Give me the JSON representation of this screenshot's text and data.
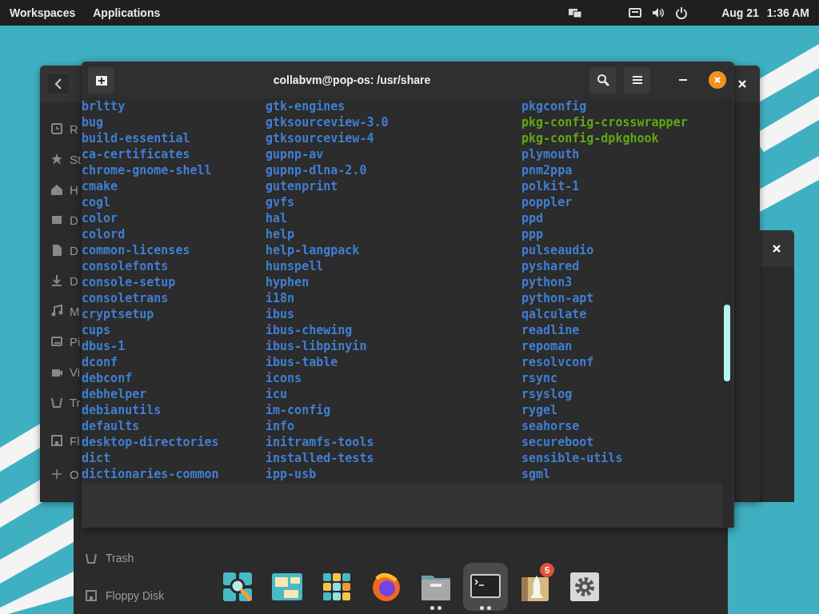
{
  "top_bar": {
    "menus": [
      "Workspaces",
      "Applications"
    ],
    "date": "Aug 21",
    "time": "1:36 AM"
  },
  "back_window": {
    "sidebar": [
      "R",
      "St",
      "H",
      "D",
      "D",
      "D",
      "M",
      "Pi",
      "Vi",
      "Tr",
      "Fl",
      "O"
    ]
  },
  "lower_window": {
    "sidebar": [
      "Trash",
      "Floppy Disk"
    ]
  },
  "terminal": {
    "title": "collabvm@pop-os: /usr/share",
    "columns": [
      [
        {
          "name": "brltty",
          "kind": "dir"
        },
        {
          "name": "bug",
          "kind": "dir"
        },
        {
          "name": "build-essential",
          "kind": "dir"
        },
        {
          "name": "ca-certificates",
          "kind": "dir"
        },
        {
          "name": "chrome-gnome-shell",
          "kind": "dir"
        },
        {
          "name": "cmake",
          "kind": "dir"
        },
        {
          "name": "cogl",
          "kind": "dir"
        },
        {
          "name": "color",
          "kind": "dir"
        },
        {
          "name": "colord",
          "kind": "dir"
        },
        {
          "name": "common-licenses",
          "kind": "dir"
        },
        {
          "name": "consolefonts",
          "kind": "dir"
        },
        {
          "name": "console-setup",
          "kind": "dir"
        },
        {
          "name": "consoletrans",
          "kind": "dir"
        },
        {
          "name": "cryptsetup",
          "kind": "dir"
        },
        {
          "name": "cups",
          "kind": "dir"
        },
        {
          "name": "dbus-1",
          "kind": "dir"
        },
        {
          "name": "dconf",
          "kind": "dir"
        },
        {
          "name": "debconf",
          "kind": "dir"
        },
        {
          "name": "debhelper",
          "kind": "dir"
        },
        {
          "name": "debianutils",
          "kind": "dir"
        },
        {
          "name": "defaults",
          "kind": "dir"
        },
        {
          "name": "desktop-directories",
          "kind": "dir"
        },
        {
          "name": "dict",
          "kind": "dir"
        },
        {
          "name": "dictionaries-common",
          "kind": "dir"
        }
      ],
      [
        {
          "name": "gtk-engines",
          "kind": "dir"
        },
        {
          "name": "gtksourceview-3.0",
          "kind": "dir"
        },
        {
          "name": "gtksourceview-4",
          "kind": "dir"
        },
        {
          "name": "gupnp-av",
          "kind": "dir"
        },
        {
          "name": "gupnp-dlna-2.0",
          "kind": "dir"
        },
        {
          "name": "gutenprint",
          "kind": "dir"
        },
        {
          "name": "gvfs",
          "kind": "dir"
        },
        {
          "name": "hal",
          "kind": "dir"
        },
        {
          "name": "help",
          "kind": "dir"
        },
        {
          "name": "help-langpack",
          "kind": "dir"
        },
        {
          "name": "hunspell",
          "kind": "dir"
        },
        {
          "name": "hyphen",
          "kind": "dir"
        },
        {
          "name": "i18n",
          "kind": "dir"
        },
        {
          "name": "ibus",
          "kind": "dir"
        },
        {
          "name": "ibus-chewing",
          "kind": "dir"
        },
        {
          "name": "ibus-libpinyin",
          "kind": "dir"
        },
        {
          "name": "ibus-table",
          "kind": "dir"
        },
        {
          "name": "icons",
          "kind": "dir"
        },
        {
          "name": "icu",
          "kind": "dir"
        },
        {
          "name": "im-config",
          "kind": "dir"
        },
        {
          "name": "info",
          "kind": "dir"
        },
        {
          "name": "initramfs-tools",
          "kind": "dir"
        },
        {
          "name": "installed-tests",
          "kind": "dir"
        },
        {
          "name": "ipp-usb",
          "kind": "dir"
        }
      ],
      [
        {
          "name": "pkgconfig",
          "kind": "dir"
        },
        {
          "name": "pkg-config-crosswrapper",
          "kind": "exec"
        },
        {
          "name": "pkg-config-dpkghook",
          "kind": "exec"
        },
        {
          "name": "plymouth",
          "kind": "dir"
        },
        {
          "name": "pnm2ppa",
          "kind": "dir"
        },
        {
          "name": "polkit-1",
          "kind": "dir"
        },
        {
          "name": "poppler",
          "kind": "dir"
        },
        {
          "name": "ppd",
          "kind": "dir"
        },
        {
          "name": "ppp",
          "kind": "dir"
        },
        {
          "name": "pulseaudio",
          "kind": "dir"
        },
        {
          "name": "pyshared",
          "kind": "dir"
        },
        {
          "name": "python3",
          "kind": "dir"
        },
        {
          "name": "python-apt",
          "kind": "dir"
        },
        {
          "name": "qalculate",
          "kind": "dir"
        },
        {
          "name": "readline",
          "kind": "dir"
        },
        {
          "name": "repoman",
          "kind": "dir"
        },
        {
          "name": "resolvconf",
          "kind": "dir"
        },
        {
          "name": "rsync",
          "kind": "dir"
        },
        {
          "name": "rsyslog",
          "kind": "dir"
        },
        {
          "name": "rygel",
          "kind": "dir"
        },
        {
          "name": "seahorse",
          "kind": "dir"
        },
        {
          "name": "secureboot",
          "kind": "dir"
        },
        {
          "name": "sensible-utils",
          "kind": "dir"
        },
        {
          "name": "sgml",
          "kind": "dir"
        }
      ]
    ]
  },
  "dock": [
    {
      "kind": "search",
      "selected": false,
      "running": false
    },
    {
      "kind": "tiles",
      "selected": false,
      "running": false
    },
    {
      "kind": "grid",
      "selected": false,
      "running": false
    },
    {
      "kind": "browser",
      "selected": false,
      "running": false
    },
    {
      "kind": "files",
      "selected": false,
      "running": true
    },
    {
      "kind": "terminal",
      "selected": true,
      "running": true
    },
    {
      "kind": "store",
      "selected": false,
      "running": false,
      "badge": "5"
    },
    {
      "kind": "settings",
      "selected": false,
      "running": false
    }
  ]
}
